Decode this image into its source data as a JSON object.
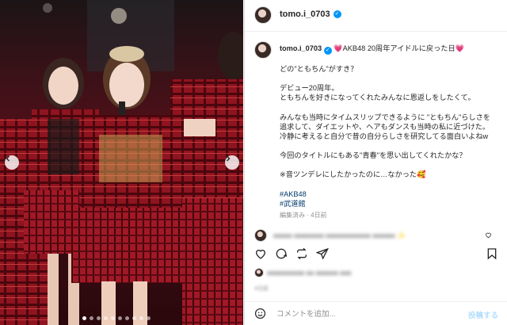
{
  "post": {
    "username": "tomo.i_0703",
    "caption_title": "💗AKB48 20周年アイドルに戻った日💗",
    "caption_lines": [
      "どの\"ともちん\"がすき？",
      "",
      "デビュー20周年。",
      "ともちんを好きになってくれたみんなに恩返しをしたくて。",
      "",
      "みんなも当時にタイムスリップできるように \"ともちん\"らしさを",
      "追求して、ダイエットや、ヘアもダンスも当時の私に近づけた。",
      "冷静に考えると自分で昔の自分らしさを研究してる面白いよねw",
      "",
      "今回のタイトルにもある\"青春\"を思い出してくれたかな？",
      "",
      "※音ツンデレにしたかったのに…なかった🥰"
    ],
    "hashtags": [
      "#AKB48",
      "#武道館"
    ],
    "meta": "編集済み · 4日前"
  },
  "comments": [
    {
      "text": "ooooo oooooooo oooooooooooo oooooo ✨",
      "blurred": true
    }
  ],
  "likes_text": "oooooooooo oo oooooo ooo",
  "time_small": "4日前",
  "comment_box": {
    "placeholder": "コメントを追加...",
    "post_label": "投稿する"
  },
  "carousel": {
    "slides": 10,
    "active": 0
  },
  "colors": {
    "accent": "#0095f6",
    "link": "#00376b",
    "muted": "#8e8e8e"
  }
}
